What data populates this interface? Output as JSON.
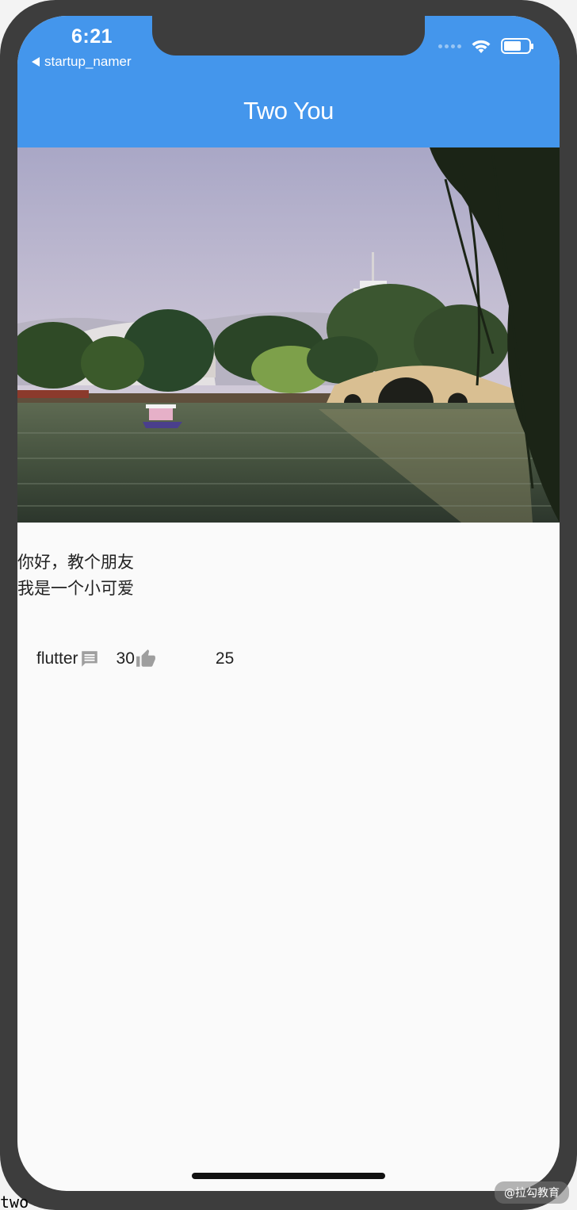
{
  "status_bar": {
    "time": "6:21",
    "back_label": "startup_namer",
    "battery_level": 0.7
  },
  "app_bar": {
    "title": "Two You",
    "color": "#4496ec"
  },
  "photo": {
    "icon": "lake-bridge-photo"
  },
  "post": {
    "lines": [
      "你好，教个朋友",
      "我是一个小可爱"
    ],
    "tag": "flutter",
    "comment_icon": "comment-icon",
    "comments": "30",
    "like_icon": "thumb-up-icon",
    "likes": "25"
  },
  "overlay": {
    "watermark": "@拉勾教育",
    "corner_text": "two"
  }
}
